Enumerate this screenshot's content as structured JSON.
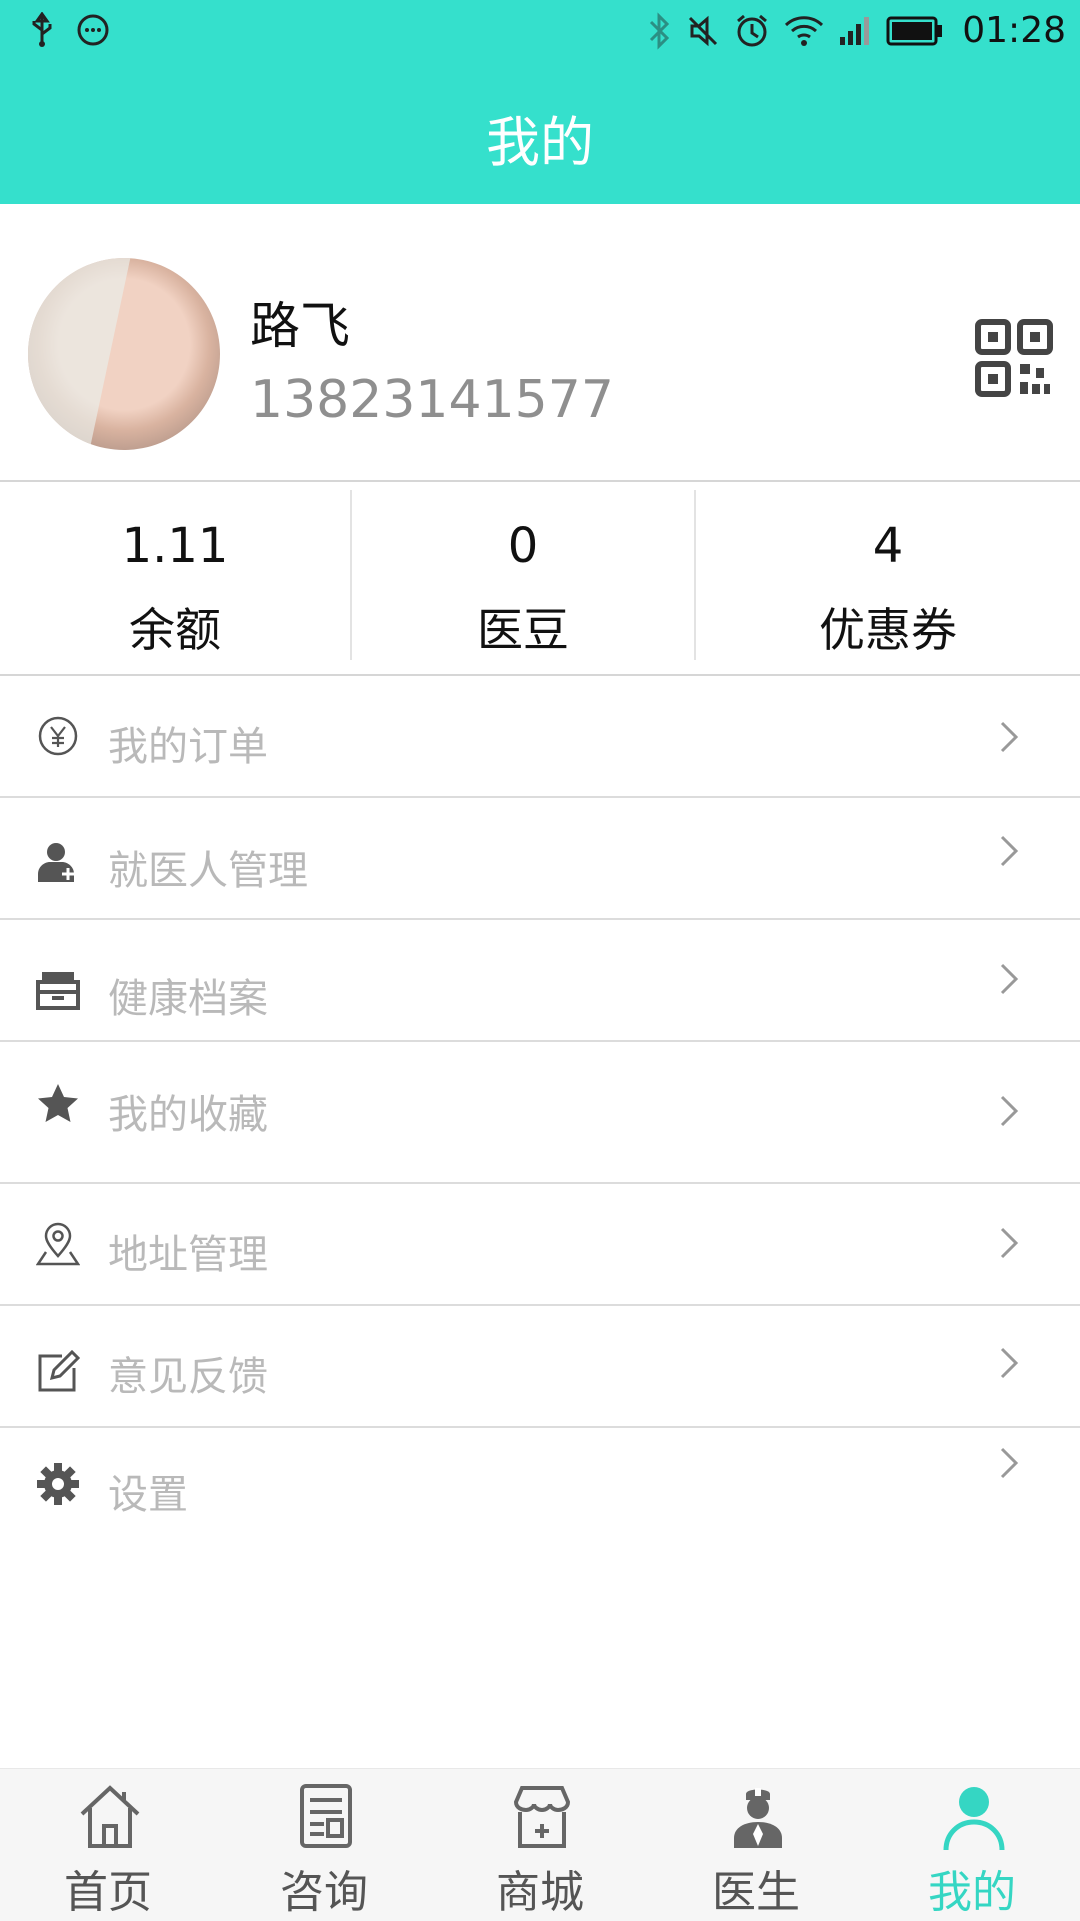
{
  "status_bar": {
    "left_icons": [
      "usb-icon",
      "chat-bubble-icon"
    ],
    "right_icons": [
      "bluetooth-icon",
      "mute-icon",
      "alarm-icon",
      "wifi-icon",
      "signal-icon",
      "battery-icon"
    ],
    "time": "01:28"
  },
  "header": {
    "title": "我的"
  },
  "profile": {
    "name": "路飞",
    "phone": "13823141577",
    "qr_icon": "qr-code-icon"
  },
  "stats": [
    {
      "value": "1.11",
      "label": "余额"
    },
    {
      "value": "0",
      "label": "医豆"
    },
    {
      "value": "4",
      "label": "优惠券"
    }
  ],
  "menu": [
    {
      "label": "我的订单",
      "icon": "yen-circle-icon"
    },
    {
      "label": "就医人管理",
      "icon": "patient-icon"
    },
    {
      "label": "健康档案",
      "icon": "archive-box-icon"
    },
    {
      "label": "我的收藏",
      "icon": "star-icon"
    },
    {
      "label": "地址管理",
      "icon": "location-pin-icon"
    },
    {
      "label": "意见反馈",
      "icon": "edit-icon"
    },
    {
      "label": "设置",
      "icon": "gear-icon"
    }
  ],
  "tabs": [
    {
      "label": "首页",
      "icon": "home-icon"
    },
    {
      "label": "咨询",
      "icon": "document-icon"
    },
    {
      "label": "商城",
      "icon": "shop-icon"
    },
    {
      "label": "医生",
      "icon": "doctor-icon"
    },
    {
      "label": "我的",
      "icon": "person-icon",
      "active": true
    }
  ],
  "colors": {
    "accent": "#35e0cc",
    "muted_text": "#b9b9b9"
  }
}
